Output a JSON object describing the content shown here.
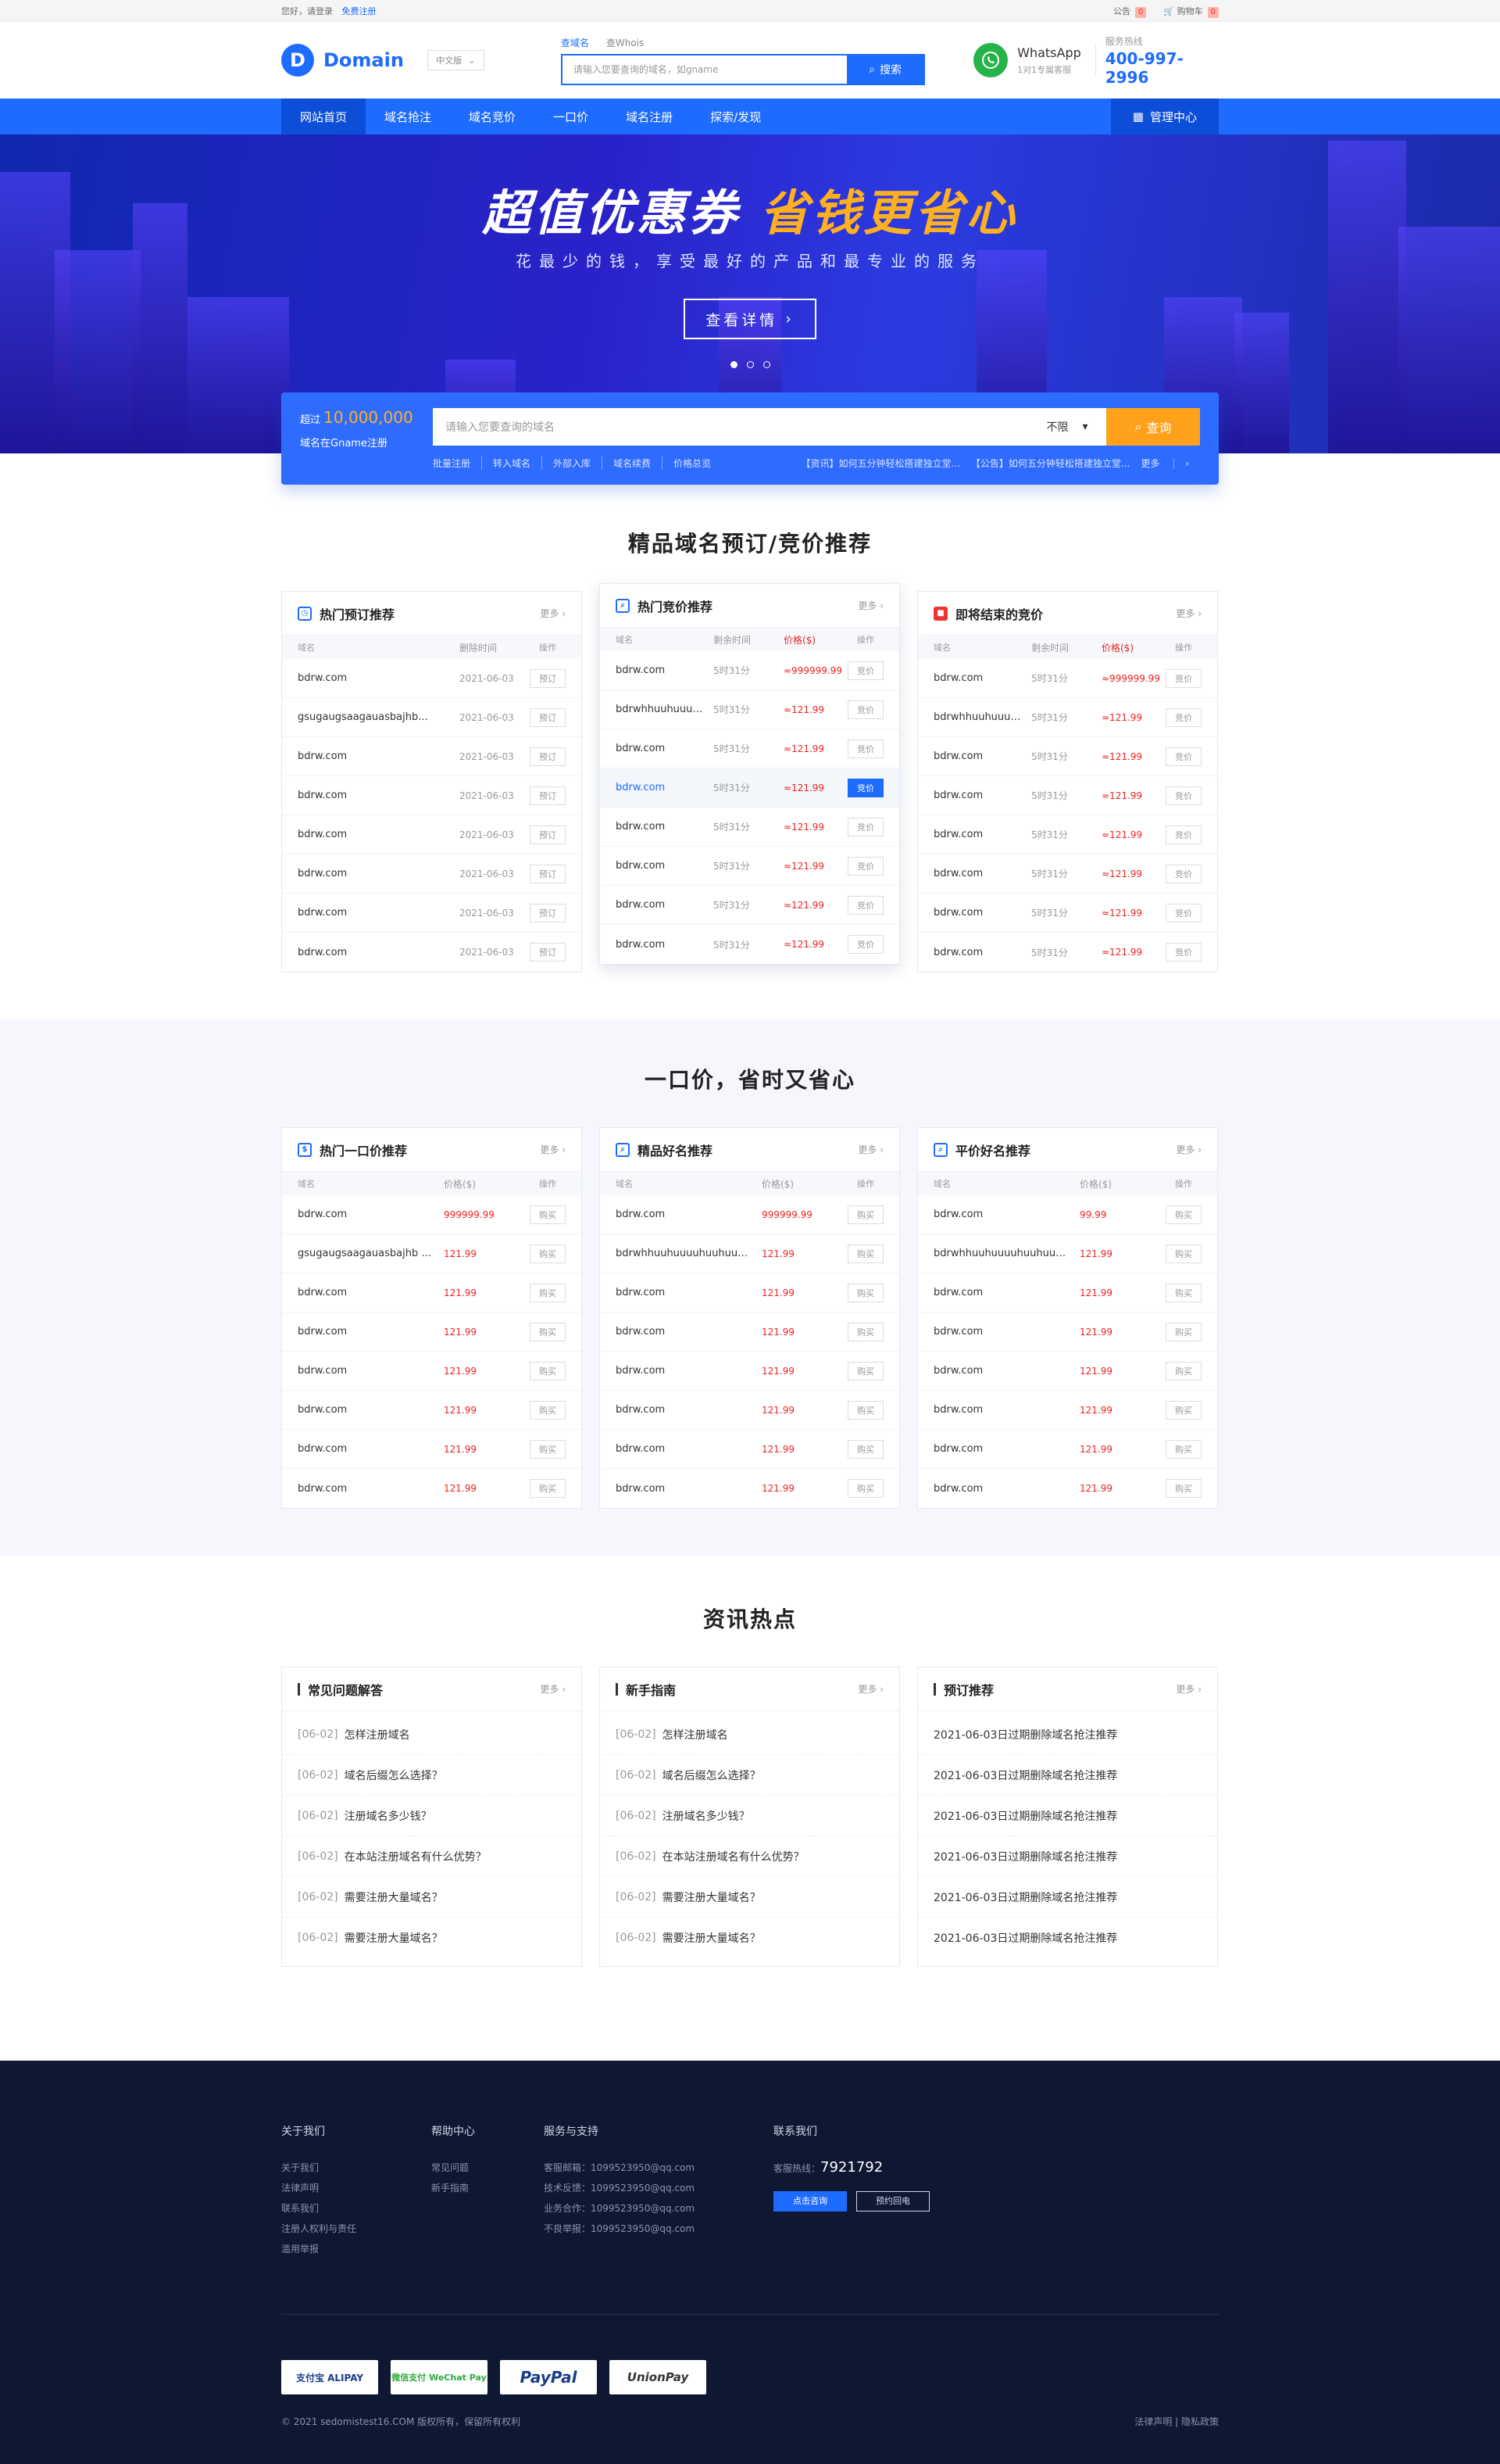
{
  "topbar": {
    "greeting": "您好，请登录",
    "register": "免费注册",
    "notice": "公告",
    "notice_count": "0",
    "cart": "购物车",
    "cart_count": "0"
  },
  "header": {
    "logo_letter": "D",
    "logo_text": "Domain",
    "lang": "中文版",
    "search_tabs": [
      "查域名",
      "查Whois"
    ],
    "search_placeholder": "请输入您要查询的域名，如gname",
    "search_button": "搜索",
    "whatsapp_title": "WhatsApp",
    "whatsapp_sub": "1对1专属客服",
    "hotline_label": "服务热线",
    "hotline": "400-997-2996"
  },
  "nav": {
    "items": [
      "网站首页",
      "域名抢注",
      "域名竞价",
      "一口价",
      "域名注册",
      "探索/发现"
    ],
    "manage": "管理中心"
  },
  "banner": {
    "title_white": "超值优惠券",
    "title_yellow": "省钱更省心",
    "subtitle": "花最少的钱，享受最好的产品和最专业的服务",
    "button": "查看详情"
  },
  "search_card": {
    "line1_prefix": "超过",
    "line1_num": "10,000,000",
    "line2": "域名在Gname注册",
    "placeholder": "请输入您要查询的域名",
    "select": "不限",
    "query": "查询",
    "links": [
      "批量注册",
      "转入域名",
      "外部入库",
      "域名续费",
      "价格总览"
    ],
    "news": [
      "【资讯】如何五分钟轻松搭建独立堂...",
      "【公告】如何五分钟轻松搭建独立堂..."
    ],
    "more": "更多"
  },
  "sec1": {
    "title": "精品域名预订/竞价推荐",
    "card1": {
      "title": "热门预订推荐",
      "more": "更多",
      "cols": [
        "域名",
        "删除时间",
        "操作"
      ],
      "rows": [
        {
          "d": "bdrw.com",
          "t": "2021-06-03",
          "a": "预订"
        },
        {
          "d": "gsugaugsaagauasbajhb...",
          "t": "2021-06-03",
          "a": "预订"
        },
        {
          "d": "bdrw.com",
          "t": "2021-06-03",
          "a": "预订"
        },
        {
          "d": "bdrw.com",
          "t": "2021-06-03",
          "a": "预订"
        },
        {
          "d": "bdrw.com",
          "t": "2021-06-03",
          "a": "预订"
        },
        {
          "d": "bdrw.com",
          "t": "2021-06-03",
          "a": "预订"
        },
        {
          "d": "bdrw.com",
          "t": "2021-06-03",
          "a": "预订"
        },
        {
          "d": "bdrw.com",
          "t": "2021-06-03",
          "a": "预订"
        }
      ]
    },
    "card2": {
      "title": "热门竞价推荐",
      "more": "更多",
      "cols": [
        "域名",
        "剩余时间",
        "价格($)",
        "操作"
      ],
      "rows": [
        {
          "d": "bdrw.com",
          "t": "5时31分",
          "p": "≈999999.99",
          "a": "竞价"
        },
        {
          "d": "bdrwhhuuhuuuu...",
          "t": "5时31分",
          "p": "≈121.99",
          "a": "竞价"
        },
        {
          "d": "bdrw.com",
          "t": "5时31分",
          "p": "≈121.99",
          "a": "竞价"
        },
        {
          "d": "bdrw.com",
          "t": "5时31分",
          "p": "≈121.99",
          "a": "竞价"
        },
        {
          "d": "bdrw.com",
          "t": "5时31分",
          "p": "≈121.99",
          "a": "竞价"
        },
        {
          "d": "bdrw.com",
          "t": "5时31分",
          "p": "≈121.99",
          "a": "竞价"
        },
        {
          "d": "bdrw.com",
          "t": "5时31分",
          "p": "≈121.99",
          "a": "竞价"
        },
        {
          "d": "bdrw.com",
          "t": "5时31分",
          "p": "≈121.99",
          "a": "竞价"
        }
      ]
    },
    "card3": {
      "title": "即将结束的竞价",
      "more": "更多",
      "cols": [
        "域名",
        "剩余时间",
        "价格($)",
        "操作"
      ],
      "rows": [
        {
          "d": "bdrw.com",
          "t": "5时31分",
          "p": "≈999999.99",
          "a": "竞价"
        },
        {
          "d": "bdrwhhuuhuuuu...",
          "t": "5时31分",
          "p": "≈121.99",
          "a": "竞价"
        },
        {
          "d": "bdrw.com",
          "t": "5时31分",
          "p": "≈121.99",
          "a": "竞价"
        },
        {
          "d": "bdrw.com",
          "t": "5时31分",
          "p": "≈121.99",
          "a": "竞价"
        },
        {
          "d": "bdrw.com",
          "t": "5时31分",
          "p": "≈121.99",
          "a": "竞价"
        },
        {
          "d": "bdrw.com",
          "t": "5时31分",
          "p": "≈121.99",
          "a": "竞价"
        },
        {
          "d": "bdrw.com",
          "t": "5时31分",
          "p": "≈121.99",
          "a": "竞价"
        },
        {
          "d": "bdrw.com",
          "t": "5时31分",
          "p": "≈121.99",
          "a": "竞价"
        }
      ]
    }
  },
  "sec2": {
    "title": "一口价，省时又省心",
    "card1": {
      "title": "热门一口价推荐",
      "more": "更多",
      "cols": [
        "域名",
        "价格($)",
        "操作"
      ],
      "rows": [
        {
          "d": "bdrw.com",
          "p": "999999.99",
          "a": "购买"
        },
        {
          "d": "gsugaugsaagauasbajhb uuu...",
          "p": "121.99",
          "a": "购买"
        },
        {
          "d": "bdrw.com",
          "p": "121.99",
          "a": "购买"
        },
        {
          "d": "bdrw.com",
          "p": "121.99",
          "a": "购买"
        },
        {
          "d": "bdrw.com",
          "p": "121.99",
          "a": "购买"
        },
        {
          "d": "bdrw.com",
          "p": "121.99",
          "a": "购买"
        },
        {
          "d": "bdrw.com",
          "p": "121.99",
          "a": "购买"
        },
        {
          "d": "bdrw.com",
          "p": "121.99",
          "a": "购买"
        }
      ]
    },
    "card2": {
      "title": "精品好名推荐",
      "more": "更多",
      "cols": [
        "域名",
        "价格($)",
        "操作"
      ],
      "rows": [
        {
          "d": "bdrw.com",
          "p": "999999.99",
          "a": "购买"
        },
        {
          "d": "bdrwhhuuhuuuuhuuhuuuu...",
          "p": "121.99",
          "a": "购买"
        },
        {
          "d": "bdrw.com",
          "p": "121.99",
          "a": "购买"
        },
        {
          "d": "bdrw.com",
          "p": "121.99",
          "a": "购买"
        },
        {
          "d": "bdrw.com",
          "p": "121.99",
          "a": "购买"
        },
        {
          "d": "bdrw.com",
          "p": "121.99",
          "a": "购买"
        },
        {
          "d": "bdrw.com",
          "p": "121.99",
          "a": "购买"
        },
        {
          "d": "bdrw.com",
          "p": "121.99",
          "a": "购买"
        }
      ]
    },
    "card3": {
      "title": "平价好名推荐",
      "more": "更多",
      "cols": [
        "域名",
        "价格($)",
        "操作"
      ],
      "rows": [
        {
          "d": "bdrw.com",
          "p": "99.99",
          "a": "购买"
        },
        {
          "d": "bdrwhhuuhuuuuhuuhuuuu...",
          "p": "121.99",
          "a": "购买"
        },
        {
          "d": "bdrw.com",
          "p": "121.99",
          "a": "购买"
        },
        {
          "d": "bdrw.com",
          "p": "121.99",
          "a": "购买"
        },
        {
          "d": "bdrw.com",
          "p": "121.99",
          "a": "购买"
        },
        {
          "d": "bdrw.com",
          "p": "121.99",
          "a": "购买"
        },
        {
          "d": "bdrw.com",
          "p": "121.99",
          "a": "购买"
        },
        {
          "d": "bdrw.com",
          "p": "121.99",
          "a": "购买"
        }
      ]
    }
  },
  "sec3": {
    "title": "资讯热点",
    "card1": {
      "title": "常见问题解答",
      "more": "更多",
      "items": [
        {
          "d": "[06-02]",
          "t": "怎样注册域名"
        },
        {
          "d": "[06-02]",
          "t": "域名后缀怎么选择？"
        },
        {
          "d": "[06-02]",
          "t": "注册域名多少钱？"
        },
        {
          "d": "[06-02]",
          "t": "在本站注册域名有什么优势？"
        },
        {
          "d": "[06-02]",
          "t": "需要注册大量域名？"
        },
        {
          "d": "[06-02]",
          "t": "需要注册大量域名？"
        }
      ]
    },
    "card2": {
      "title": "新手指南",
      "more": "更多",
      "items": [
        {
          "d": "[06-02]",
          "t": "怎样注册域名"
        },
        {
          "d": "[06-02]",
          "t": "域名后缀怎么选择？"
        },
        {
          "d": "[06-02]",
          "t": "注册域名多少钱？"
        },
        {
          "d": "[06-02]",
          "t": "在本站注册域名有什么优势？"
        },
        {
          "d": "[06-02]",
          "t": "需要注册大量域名？"
        },
        {
          "d": "[06-02]",
          "t": "需要注册大量域名？"
        }
      ]
    },
    "card3": {
      "title": "预订推荐",
      "more": "更多",
      "items": [
        {
          "d": "",
          "t": "2021-06-03日过期删除域名抢注推荐"
        },
        {
          "d": "",
          "t": "2021-06-03日过期删除域名抢注推荐"
        },
        {
          "d": "",
          "t": "2021-06-03日过期删除域名抢注推荐"
        },
        {
          "d": "",
          "t": "2021-06-03日过期删除域名抢注推荐"
        },
        {
          "d": "",
          "t": "2021-06-03日过期删除域名抢注推荐"
        },
        {
          "d": "",
          "t": "2021-06-03日过期删除域名抢注推荐"
        }
      ]
    }
  },
  "footer": {
    "col1": {
      "title": "关于我们",
      "items": [
        "关于我们",
        "法律声明",
        "联系我们",
        "注册人权利与责任",
        "滥用举报"
      ]
    },
    "col2": {
      "title": "帮助中心",
      "items": [
        "常见问题",
        "新手指南"
      ]
    },
    "col3": {
      "title": "服务与支持",
      "items": [
        "客服邮箱：1099523950@qq.com",
        "技术反馈：1099523950@qq.com",
        "业务合作：1099523950@qq.com",
        "不良举报：1099523950@qq.com"
      ]
    },
    "col4": {
      "title": "联系我们",
      "hotline_label": "客服热线：",
      "hotline": "7921792",
      "btn1": "点击咨询",
      "btn2": "预约回电"
    },
    "pays": [
      "支付宝 ALIPAY",
      "微信支付 WeChat Pay",
      "PayPal",
      "UnionPay"
    ],
    "copyright": "© 2021 sedomistest16.COM 版权所有，保留所有权利",
    "legal": "法律声明 | 隐私政策"
  }
}
